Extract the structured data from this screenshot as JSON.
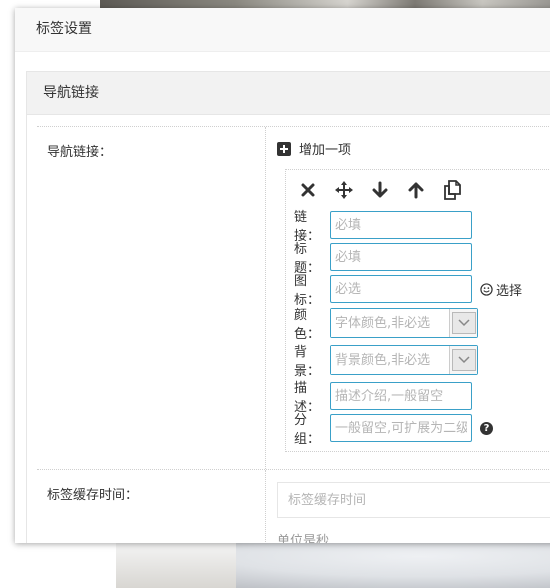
{
  "dialog": {
    "title": "标签设置"
  },
  "panel": {
    "title": "导航链接"
  },
  "nav_row": {
    "label": "导航链接：",
    "add_label": "增加一项",
    "fields": [
      {
        "label": "链接：",
        "placeholder": "必填"
      },
      {
        "label": "标题：",
        "placeholder": "必填"
      },
      {
        "label": "图标：",
        "placeholder": "必选"
      },
      {
        "label": "颜色：",
        "placeholder": "字体颜色,非必选"
      },
      {
        "label": "背景：",
        "placeholder": "背景颜色,非必选"
      },
      {
        "label": "描述：",
        "placeholder": "描述介绍,一般留空"
      },
      {
        "label": "分组：",
        "placeholder": "一般留空,可扩展为二级"
      }
    ],
    "icon_select_label": "选择",
    "help_glyph": "?"
  },
  "cache_row": {
    "label": "标签缓存时间：",
    "placeholder": "标签缓存时间",
    "hint": "单位是秒"
  },
  "icons": {
    "delete": "close-icon",
    "move": "move-icon",
    "down": "arrow-down-icon",
    "up": "arrow-up-icon",
    "copy": "copy-icon",
    "smile": "smile-icon"
  },
  "colors": {
    "accent": "#3aa0c8"
  }
}
